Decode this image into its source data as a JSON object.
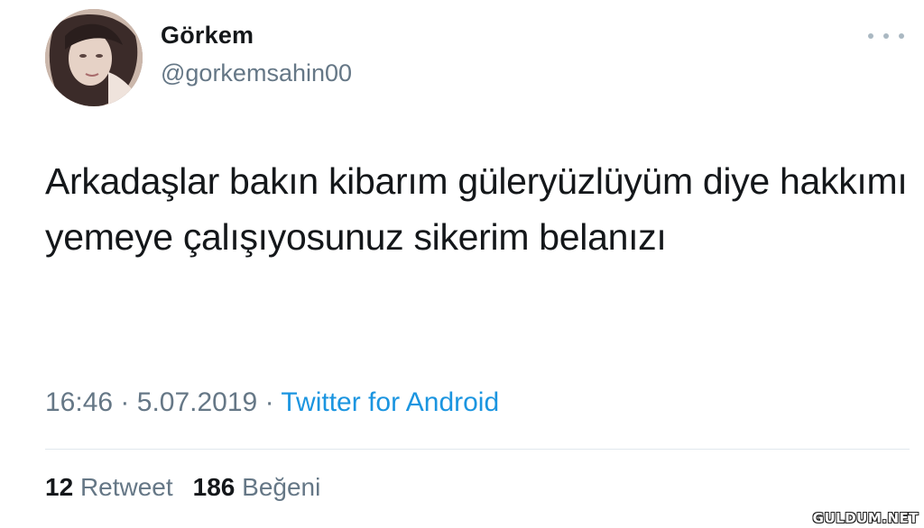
{
  "tweet": {
    "author": {
      "display_name": "Görkem",
      "handle": "@gorkemsahin00"
    },
    "text": "Arkadaşlar bakın kibarım güleryüzlüyüm diye hakkımı yemeye çalışıyosunuz sikerim belanızı",
    "time": "16:46",
    "separator": "·",
    "date": "5.07.2019",
    "source": "Twitter for Android",
    "stats": {
      "retweet_count": "12",
      "retweet_label": "Retweet",
      "like_count": "186",
      "like_label": "Beğeni"
    }
  },
  "watermark": "GULDUM.NET",
  "icons": {
    "more": "more-horizontal-icon",
    "avatar": "profile-photo"
  },
  "colors": {
    "text": "#14171a",
    "secondary": "#657786",
    "link": "#1b95e0",
    "divider": "#e1e8ed"
  }
}
